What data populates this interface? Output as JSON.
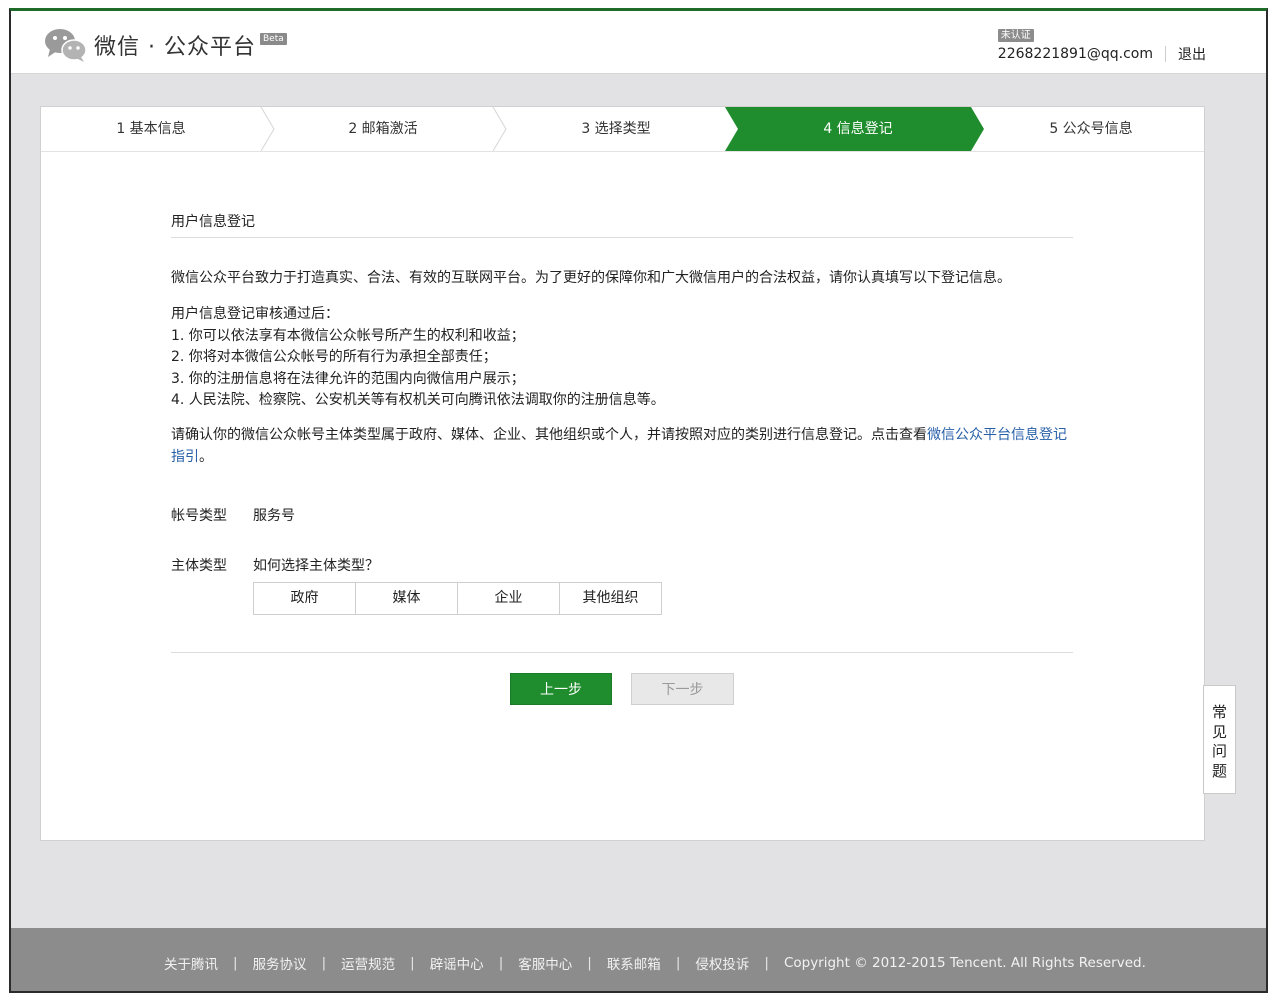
{
  "header": {
    "logo_text": "微信 · 公众平台",
    "beta": "Beta",
    "badge": "未认证",
    "email": "2268221891@qq.com",
    "logout": "退出"
  },
  "steps": [
    {
      "label": "1 基本信息",
      "active": false
    },
    {
      "label": "2 邮箱激活",
      "active": false
    },
    {
      "label": "3 选择类型",
      "active": false
    },
    {
      "label": "4 信息登记",
      "active": true
    },
    {
      "label": "5 公众号信息",
      "active": false
    }
  ],
  "content": {
    "section_title": "用户信息登记",
    "intro": "微信公众平台致力于打造真实、合法、有效的互联网平台。为了更好的保障你和广大微信用户的合法权益，请你认真填写以下登记信息。",
    "after_title": "用户信息登记审核通过后：",
    "after_items": [
      "1. 你可以依法享有本微信公众帐号所产生的权利和收益；",
      "2. 你将对本微信公众帐号的所有行为承担全部责任；",
      "3. 你的注册信息将在法律允许的范围内向微信用户展示；",
      "4. 人民法院、检察院、公安机关等有权机关可向腾讯依法调取你的注册信息等。"
    ],
    "confirm_text": "请确认你的微信公众帐号主体类型属于政府、媒体、企业、其他组织或个人，并请按照对应的类别进行信息登记。点击查看",
    "confirm_link": "微信公众平台信息登记指引",
    "confirm_end": "。",
    "account_type_label": "帐号类型",
    "account_type_value": "服务号",
    "entity_type_label": "主体类型",
    "entity_help_link": "如何选择主体类型？",
    "entity_options": [
      "政府",
      "媒体",
      "企业",
      "其他组织"
    ],
    "prev_button": "上一步",
    "next_button": "下一步"
  },
  "faq": [
    "常",
    "见",
    "问",
    "题"
  ],
  "footer": {
    "links": [
      "关于腾讯",
      "服务协议",
      "运营规范",
      "辟谣中心",
      "客服中心",
      "联系邮箱",
      "侵权投诉"
    ],
    "separator": "|",
    "copyright": "Copyright © 2012-2015 Tencent. All Rights Reserved."
  },
  "colors": {
    "accent_green": "#1f8d2d",
    "link_blue": "#2860a8",
    "footer_gray": "#8c8c8c"
  }
}
